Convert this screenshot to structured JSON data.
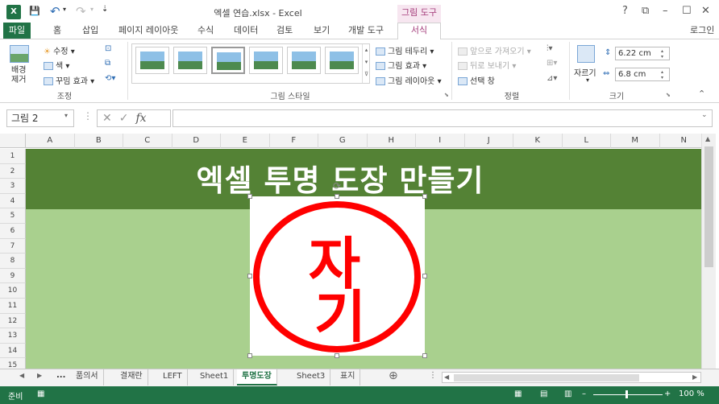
{
  "window": {
    "doc_title": "엑셀 연습.xlsx - Excel",
    "context_tab": "그림 도구",
    "help": "?",
    "restore_ribbon": "⧉",
    "minimize": "–",
    "maximize": "☐",
    "close": "✕"
  },
  "tabs": {
    "file": "파일",
    "items": [
      "홈",
      "삽입",
      "페이지 레이아웃",
      "수식",
      "데이터",
      "검토",
      "보기",
      "개발 도구"
    ],
    "format": "서식",
    "sign_in": "로그인"
  },
  "ribbon": {
    "adjust": {
      "remove_bg": "배경\n제거",
      "corrections": "수정",
      "color": "색",
      "artistic": "꾸밈 효과",
      "label": "조정"
    },
    "styles": {
      "border": "그림 테두리",
      "effects": "그림 효과",
      "layout": "그림 레이아웃",
      "label": "그림 스타일"
    },
    "arrange": {
      "bring_forward": "앞으로 가져오기",
      "send_backward": "뒤로 보내기",
      "selection_pane": "선택 창",
      "label": "정렬"
    },
    "size": {
      "crop": "자르기",
      "height": "6.22 cm",
      "width": "6.8 cm",
      "label": "크기"
    }
  },
  "formula_bar": {
    "name_box": "그림 2",
    "fx": "fx",
    "formula": ""
  },
  "grid": {
    "columns": [
      "A",
      "B",
      "C",
      "D",
      "E",
      "F",
      "G",
      "H",
      "I",
      "J",
      "K",
      "L",
      "M",
      "N"
    ],
    "rows": [
      "1",
      "2",
      "3",
      "4",
      "5",
      "6",
      "7",
      "8",
      "9",
      "10",
      "11",
      "12",
      "13",
      "14",
      "15"
    ],
    "title_text": "엑셀 투명 도장 만들기",
    "header_color": "#548235",
    "body_color": "#a9d08e",
    "stamp_color": "#ff0000",
    "stamp_text": "자기"
  },
  "sheet_tabs": {
    "more": "...",
    "items": [
      "품의서",
      "결재란",
      "LEFT",
      "Sheet1",
      "투명도장",
      "Sheet3",
      "표지"
    ],
    "active": "투명도장",
    "add": "⊕"
  },
  "status": {
    "ready": "준비",
    "zoom": "100 %"
  }
}
